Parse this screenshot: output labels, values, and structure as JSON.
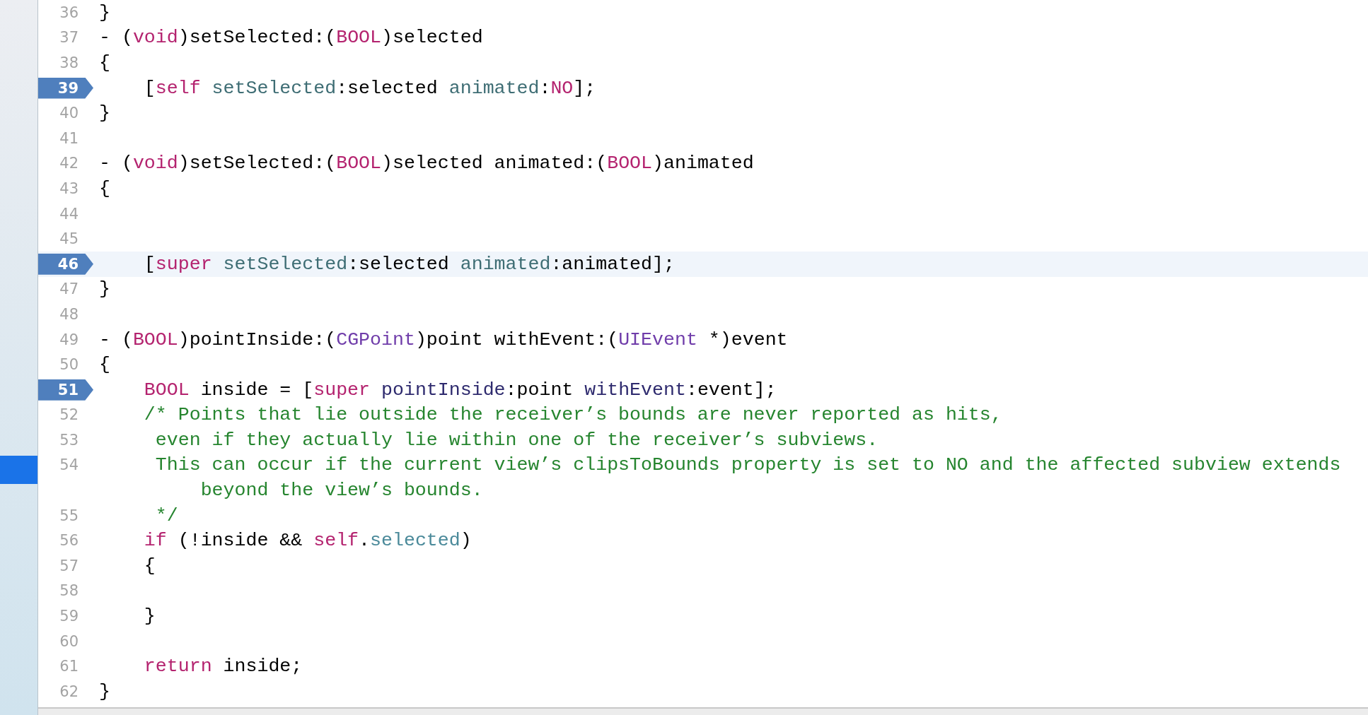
{
  "lines": [
    {
      "number": "36",
      "breakpoint": false,
      "current": false,
      "tokens": [
        {
          "kind": "plain",
          "text": "}"
        }
      ]
    },
    {
      "number": "37",
      "breakpoint": false,
      "current": false,
      "tokens": [
        {
          "kind": "plain",
          "text": "- ("
        },
        {
          "kind": "keyword",
          "text": "void"
        },
        {
          "kind": "plain",
          "text": ")setSelected:("
        },
        {
          "kind": "keyword",
          "text": "BOOL"
        },
        {
          "kind": "plain",
          "text": ")selected"
        }
      ]
    },
    {
      "number": "38",
      "breakpoint": false,
      "current": false,
      "tokens": [
        {
          "kind": "plain",
          "text": "{"
        }
      ]
    },
    {
      "number": "39",
      "breakpoint": true,
      "current": false,
      "tokens": [
        {
          "kind": "plain",
          "text": "    ["
        },
        {
          "kind": "keyword",
          "text": "self "
        },
        {
          "kind": "method",
          "text": "setSelected"
        },
        {
          "kind": "plain",
          "text": ":selected "
        },
        {
          "kind": "method",
          "text": "animated"
        },
        {
          "kind": "plain",
          "text": ":"
        },
        {
          "kind": "keyword",
          "text": "NO"
        },
        {
          "kind": "plain",
          "text": "];"
        }
      ]
    },
    {
      "number": "40",
      "breakpoint": false,
      "current": false,
      "tokens": [
        {
          "kind": "plain",
          "text": "}"
        }
      ]
    },
    {
      "number": "41",
      "breakpoint": false,
      "current": false
    },
    {
      "number": "42",
      "breakpoint": false,
      "current": false,
      "tokens": [
        {
          "kind": "plain",
          "text": "- ("
        },
        {
          "kind": "keyword",
          "text": "void"
        },
        {
          "kind": "plain",
          "text": ")setSelected:("
        },
        {
          "kind": "keyword",
          "text": "BOOL"
        },
        {
          "kind": "plain",
          "text": ")selected animated:("
        },
        {
          "kind": "keyword",
          "text": "BOOL"
        },
        {
          "kind": "plain",
          "text": ")animated"
        }
      ]
    },
    {
      "number": "43",
      "breakpoint": false,
      "current": false,
      "tokens": [
        {
          "kind": "plain",
          "text": "{"
        }
      ]
    },
    {
      "number": "44",
      "breakpoint": false,
      "current": false
    },
    {
      "number": "45",
      "breakpoint": false,
      "current": false
    },
    {
      "number": "46",
      "breakpoint": true,
      "current": true,
      "tokens": [
        {
          "kind": "plain",
          "text": "    ["
        },
        {
          "kind": "keyword",
          "text": "super "
        },
        {
          "kind": "method",
          "text": "setSelected"
        },
        {
          "kind": "plain",
          "text": ":selected "
        },
        {
          "kind": "method",
          "text": "animated"
        },
        {
          "kind": "plain",
          "text": ":animated];"
        }
      ]
    },
    {
      "number": "47",
      "breakpoint": false,
      "current": false,
      "tokens": [
        {
          "kind": "plain",
          "text": "}"
        }
      ]
    },
    {
      "number": "48",
      "breakpoint": false,
      "current": false
    },
    {
      "number": "49",
      "breakpoint": false,
      "current": false,
      "tokens": [
        {
          "kind": "plain",
          "text": "- ("
        },
        {
          "kind": "keyword",
          "text": "BOOL"
        },
        {
          "kind": "plain",
          "text": ")pointInside:("
        },
        {
          "kind": "type",
          "text": "CGPoint"
        },
        {
          "kind": "plain",
          "text": ")point withEvent:("
        },
        {
          "kind": "type",
          "text": "UIEvent"
        },
        {
          "kind": "plain",
          "text": " *)event"
        }
      ]
    },
    {
      "number": "50",
      "breakpoint": false,
      "current": false,
      "tokens": [
        {
          "kind": "plain",
          "text": "{"
        }
      ]
    },
    {
      "number": "51",
      "breakpoint": true,
      "current": false,
      "tokens": [
        {
          "kind": "keyword",
          "text": "    BOOL"
        },
        {
          "kind": "plain",
          "text": " inside = ["
        },
        {
          "kind": "keyword",
          "text": "super "
        },
        {
          "kind": "call",
          "text": "pointInside"
        },
        {
          "kind": "plain",
          "text": ":point "
        },
        {
          "kind": "call",
          "text": "withEvent"
        },
        {
          "kind": "plain",
          "text": ":event];"
        }
      ]
    },
    {
      "number": "52",
      "breakpoint": false,
      "current": false,
      "tokens": [
        {
          "kind": "comment",
          "text": "    /* Points that lie outside the receiver’s bounds are never reported as hits,"
        }
      ]
    },
    {
      "number": "53",
      "breakpoint": false,
      "current": false,
      "tokens": [
        {
          "kind": "comment",
          "text": "     even if they actually lie within one of the receiver’s subviews."
        }
      ]
    },
    {
      "number": "54",
      "breakpoint": false,
      "current": false,
      "tokens": [
        {
          "kind": "comment",
          "text": "     This can occur if the current view’s clipsToBounds property is set to NO and the affected subview extends"
        }
      ],
      "continuation": [
        {
          "kind": "comment",
          "text": "         beyond the view’s bounds."
        }
      ]
    },
    {
      "number": "55",
      "breakpoint": false,
      "current": false,
      "tokens": [
        {
          "kind": "comment",
          "text": "     */"
        }
      ]
    },
    {
      "number": "56",
      "breakpoint": false,
      "current": false,
      "tokens": [
        {
          "kind": "keyword",
          "text": "    if"
        },
        {
          "kind": "plain",
          "text": " (!inside && "
        },
        {
          "kind": "keyword",
          "text": "self"
        },
        {
          "kind": "plain",
          "text": "."
        },
        {
          "kind": "property",
          "text": "selected"
        },
        {
          "kind": "plain",
          "text": ")"
        }
      ]
    },
    {
      "number": "57",
      "breakpoint": false,
      "current": false,
      "tokens": [
        {
          "kind": "plain",
          "text": "    {"
        }
      ]
    },
    {
      "number": "58",
      "breakpoint": false,
      "current": false
    },
    {
      "number": "59",
      "breakpoint": false,
      "current": false,
      "tokens": [
        {
          "kind": "plain",
          "text": "    }"
        }
      ]
    },
    {
      "number": "60",
      "breakpoint": false,
      "current": false
    },
    {
      "number": "61",
      "breakpoint": false,
      "current": false,
      "tokens": [
        {
          "kind": "keyword",
          "text": "    return"
        },
        {
          "kind": "plain",
          "text": " inside;"
        }
      ]
    },
    {
      "number": "62",
      "breakpoint": false,
      "current": false,
      "tokens": [
        {
          "kind": "plain",
          "text": "}"
        }
      ]
    }
  ]
}
